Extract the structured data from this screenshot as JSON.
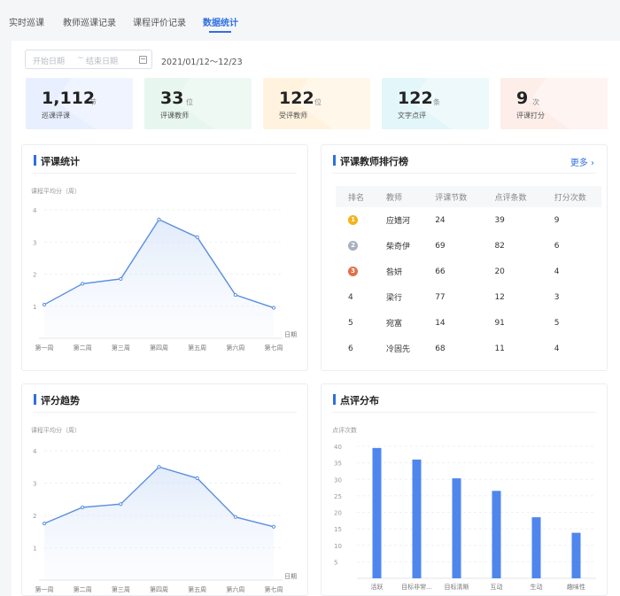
{
  "tabs": [
    "实时巡课",
    "教师巡课记录",
    "课程评价记录",
    "数据统计"
  ],
  "filter": {
    "start_placeholder": "开始日期",
    "separator": "~",
    "end_placeholder": "结束日期",
    "range_text": "2021/01/12～12/23"
  },
  "stats": [
    {
      "num": "1,112",
      "unit": "节",
      "label": "巡课评课",
      "color": "#e8efff"
    },
    {
      "num": "33",
      "unit": "位",
      "label": "评课教师",
      "color": "#e7f6ef"
    },
    {
      "num": "122",
      "unit": "位",
      "label": "受评教师",
      "color": "#fff3df"
    },
    {
      "num": "122",
      "unit": "条",
      "label": "文字点评",
      "color": "#e3f6f9"
    },
    {
      "num": "9",
      "unit": "次",
      "label": "评课打分",
      "color": "#fdeeea"
    }
  ],
  "panels": {
    "stats_title": "评课统计",
    "ranking_title": "评课教师排行榜",
    "more_label": "更多",
    "trend_title": "评分趋势",
    "dist_title": "点评分布"
  },
  "ranking": {
    "headers": [
      "排名",
      "教师",
      "评课节数",
      "点评条数",
      "打分次数"
    ],
    "rows": [
      {
        "rank": "1",
        "teacher": "应嫱河",
        "lessons": "24",
        "comments": "39",
        "scores": "9"
      },
      {
        "rank": "2",
        "teacher": "柴奇伊",
        "lessons": "69",
        "comments": "82",
        "scores": "6"
      },
      {
        "rank": "3",
        "teacher": "昝妍",
        "lessons": "66",
        "comments": "20",
        "scores": "4"
      },
      {
        "rank": "4",
        "teacher": "梁行",
        "lessons": "77",
        "comments": "12",
        "scores": "3"
      },
      {
        "rank": "5",
        "teacher": "宛富",
        "lessons": "14",
        "comments": "91",
        "scores": "5"
      },
      {
        "rank": "6",
        "teacher": "冷固先",
        "lessons": "68",
        "comments": "11",
        "scores": "4"
      }
    ]
  },
  "chart_data": [
    {
      "type": "line",
      "ylabel": "课程平均分（周）",
      "xlabel": "日期",
      "categories": [
        "第一周",
        "第二周",
        "第三周",
        "第四周",
        "第五周",
        "第六周",
        "第七周"
      ],
      "values": [
        1.05,
        1.7,
        1.85,
        3.7,
        3.15,
        1.35,
        0.95
      ],
      "ylim": [
        0,
        4
      ],
      "yticks": [
        "1",
        "2",
        "3",
        "4"
      ],
      "color": "#5b8fe0"
    },
    {
      "type": "line",
      "ylabel": "课程平均分（周）",
      "xlabel": "日期",
      "categories": [
        "第一周",
        "第二周",
        "第三周",
        "第四周",
        "第五周",
        "第六周",
        "第七周"
      ],
      "values": [
        1.75,
        2.25,
        2.35,
        3.5,
        3.15,
        1.95,
        1.65
      ],
      "ylim": [
        0,
        4
      ],
      "yticks": [
        "1",
        "2",
        "3",
        "4"
      ],
      "color": "#5b8fe0"
    },
    {
      "type": "bar",
      "ylabel": "点评次数",
      "categories": [
        "活跃",
        "目标非常...",
        "目标清晰",
        "互动",
        "生动",
        "趣味性"
      ],
      "values": [
        39.5,
        36,
        30.3,
        26.5,
        18.5,
        13.8
      ],
      "ylim": [
        0,
        40
      ],
      "yticks": [
        "5",
        "10",
        "15",
        "20",
        "25",
        "30",
        "35",
        "40"
      ],
      "color": "#4f86ee"
    }
  ]
}
